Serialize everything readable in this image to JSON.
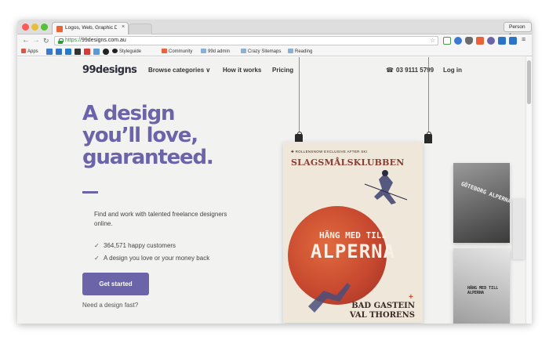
{
  "browser": {
    "tab_title": "Logos, Web, Graphic Desi",
    "tab_close": "×",
    "profile": "Person 1",
    "url_scheme": "https://",
    "url_host": "99designs.com.au",
    "bookmarks": [
      "Apps",
      "Styleguide",
      "Community",
      "99d admin",
      "Crazy Sitemaps",
      "Reading"
    ]
  },
  "site": {
    "logo": "99designs",
    "nav": {
      "browse": "Browse categories",
      "browse_caret": "∨",
      "how": "How it works",
      "pricing": "Pricing",
      "phone": "03 9111 5799",
      "login": "Log in"
    },
    "hero": {
      "headline_1": "A design",
      "headline_2": "you’ll love,",
      "headline_3": "guaranteed.",
      "subtext": "Find and work with talented freelance designers online.",
      "check_1": "364,571 happy customers",
      "check_2": "A design you love or your money back",
      "cta": "Get started",
      "below_cta": "Need a design fast?"
    },
    "poster": {
      "tagline": "ROLLENSNOW EXCLUSIVE AFTER SKI",
      "brand": "SLAGSMÅLSKLUBBEN",
      "line_1": "HÄNG MED TILL",
      "line_2": "ALPERNA",
      "city_1": "BAD GASTEIN",
      "city_2": "VAL THORENS"
    },
    "poster_small_1": "GÖTEBORG ALPERNA",
    "poster_small_2": "HÄNG MED TILL ALPERNA"
  },
  "colors": {
    "brand_purple": "#6b64a9",
    "poster_red": "#c8492f",
    "poster_bg": "#efe7da"
  }
}
